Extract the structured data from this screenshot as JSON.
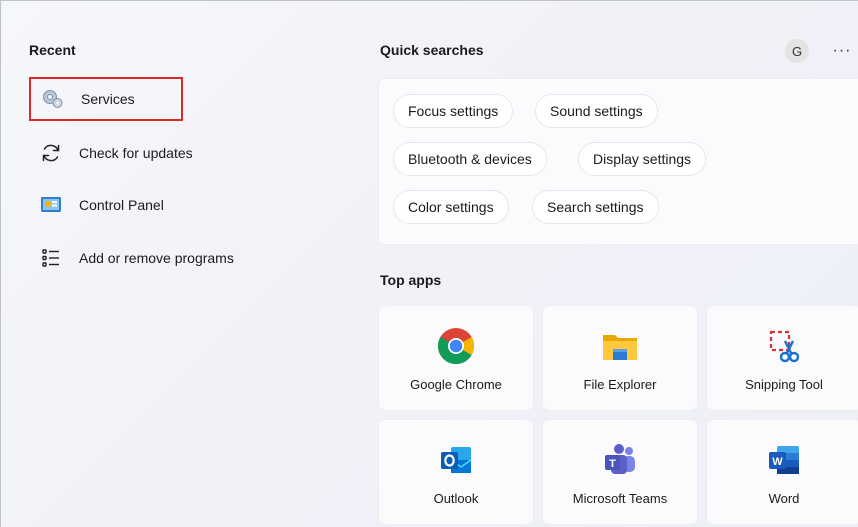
{
  "recent": {
    "heading": "Recent",
    "items": [
      {
        "label": "Services",
        "icon": "services-gear-icon"
      },
      {
        "label": "Check for updates",
        "icon": "refresh-icon"
      },
      {
        "label": "Control Panel",
        "icon": "control-panel-icon"
      },
      {
        "label": "Add or remove programs",
        "icon": "programs-list-icon"
      }
    ]
  },
  "header": {
    "avatar_initial": "G",
    "more_label": "···"
  },
  "quick_searches": {
    "heading": "Quick searches",
    "items": [
      "Focus settings",
      "Sound settings",
      "Bluetooth & devices",
      "Display settings",
      "Color settings",
      "Search settings"
    ]
  },
  "top_apps": {
    "heading": "Top apps",
    "items": [
      {
        "label": "Google Chrome",
        "icon": "chrome-icon"
      },
      {
        "label": "File Explorer",
        "icon": "folder-icon"
      },
      {
        "label": "Snipping Tool",
        "icon": "scissors-icon"
      },
      {
        "label": "Outlook",
        "icon": "outlook-icon"
      },
      {
        "label": "Microsoft Teams",
        "icon": "teams-icon"
      },
      {
        "label": "Word",
        "icon": "word-icon"
      }
    ]
  },
  "colors": {
    "highlight_border": "#d92a2a",
    "background": "#f3f4f9"
  }
}
